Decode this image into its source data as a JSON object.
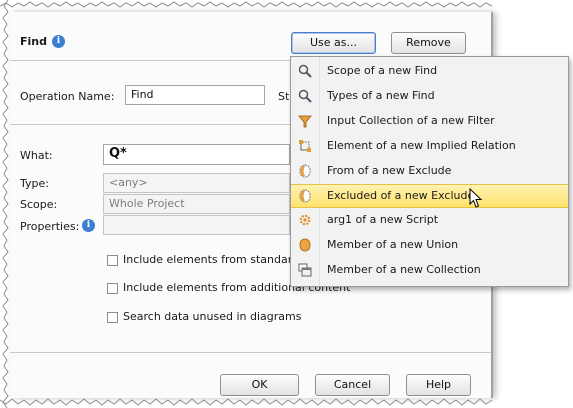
{
  "dialog": {
    "title": "Find",
    "use_as_label": "Use as...",
    "remove_label": "Remove",
    "operation_name_label": "Operation Name:",
    "operation_name_value": "Find",
    "st_fragment": "St",
    "what_label": "What:",
    "what_value": "Q*",
    "type_label": "Type:",
    "type_value": "<any>",
    "scope_label": "Scope:",
    "scope_value": "Whole Project",
    "properties_label": "Properties:",
    "checkboxes": [
      {
        "label": "Include elements from standard",
        "checked": false
      },
      {
        "label": "Include elements from additional content",
        "checked": false
      },
      {
        "label": "Search data unused in diagrams",
        "checked": false
      }
    ],
    "ok_label": "OK",
    "cancel_label": "Cancel",
    "help_label": "Help"
  },
  "menu": {
    "items": [
      {
        "label": "Scope of a new Find",
        "icon": "search-icon"
      },
      {
        "label": "Types of a new Find",
        "icon": "search-icon"
      },
      {
        "label": "Input Collection of a new Filter",
        "icon": "filter-icon"
      },
      {
        "label": "Element of a new Implied Relation",
        "icon": "implied-relation-icon"
      },
      {
        "label": "From of a new Exclude",
        "icon": "exclude-icon"
      },
      {
        "label": "Excluded of a new Exclude",
        "icon": "exclude-icon",
        "highlighted": true
      },
      {
        "label": "arg1 of a new Script",
        "icon": "gear-icon"
      },
      {
        "label": "Member of a new Union",
        "icon": "union-icon"
      },
      {
        "label": "Member of a new Collection",
        "icon": "collection-icon"
      }
    ]
  },
  "colors": {
    "highlight": "#ffe16b",
    "info_blue": "#3b7fd1",
    "accent_orange": "#e08a1e"
  }
}
